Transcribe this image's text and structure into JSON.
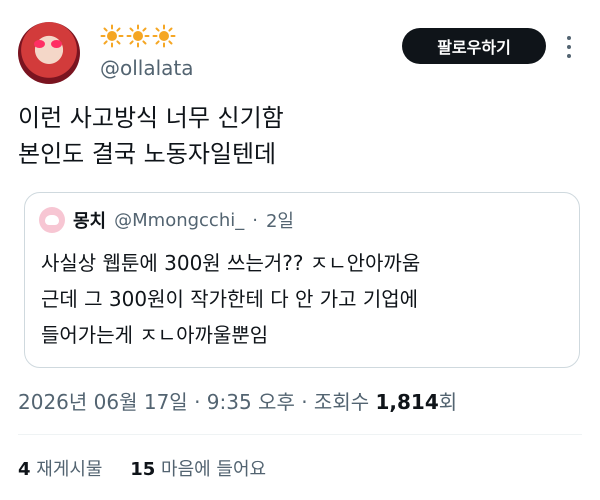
{
  "author": {
    "display_name_icons": [
      "sun-icon",
      "sun-icon",
      "sun-icon"
    ],
    "handle": "@ollalata",
    "avatar_icon": "character-avatar"
  },
  "follow_button": {
    "label": "팔로우하기"
  },
  "tweet": {
    "lines": [
      "이런 사고방식 너무 신기함",
      "본인도 결국 노동자일텐데"
    ]
  },
  "quote": {
    "name": "몽치",
    "handle": "@Mmongcchi_",
    "separator": "·",
    "time": "2일",
    "lines": [
      "사실상 웹툰에 300원 쓰는거?? ㅈㄴ안아까움",
      "근데 그 300원이 작가한테 다 안 가고 기업에",
      "들어가는게 ㅈㄴ아까울뿐임"
    ]
  },
  "meta": {
    "timestamp": "2026년 06월 17일 · 9:35 오후 · 조회수 ",
    "views": "1,814",
    "views_suffix": "회"
  },
  "stats": {
    "retweets_count": "4",
    "retweets_label": " 재게시물",
    "likes_count": "15",
    "likes_label": " 마음에 들어요"
  },
  "colors": {
    "text_primary": "#0f1419",
    "text_secondary": "#536471",
    "border": "#cfd9de",
    "sun": "#f5a623"
  }
}
